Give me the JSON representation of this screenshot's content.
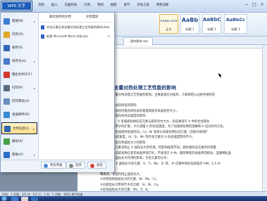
{
  "app": {
    "button_label": "WPS 文字",
    "tabs": [
      "开始",
      "插入",
      "页面布局",
      "引用",
      "审阅",
      "视图",
      "章节",
      "开发工具",
      "特色功能"
    ],
    "window_controls": [
      "−",
      "□",
      "×"
    ]
  },
  "ribbon": {
    "styles": [
      {
        "sample": "AaBbCcDd",
        "label": "正文"
      },
      {
        "sample": "AaBb",
        "label": "标题 1"
      },
      {
        "sample": "AaBbC",
        "label": "标题 2"
      },
      {
        "sample": "AaBbCc",
        "label": "标题 3"
      }
    ]
  },
  "document_tab": "...是的影响.doc",
  "document": {
    "small_header": "综述",
    "title": "及其含量对热处理工艺性能的影响",
    "lines": [
      "元素及其含量对热处理工艺性能的影响，主要表现在对加热、冷却和回火过程中组织的",
      "响。",
      "合金元素对加热转变的影响",
      "金元素对钢加热时奥氏体形成的速度和奥氏体晶粒的大小。",
      "合金元素对奥氏体形成速度的影响",
      "r、Mo、W、V 等强碳化物形成元素与碳的亲合力大，形成难溶于 A 中的合金碳化",
      "显著减慢碳原子的扩散，大大减慢 A 的形成速度。为了加速碳化物的溶解和 A 成分的均匀化，",
      "需要提高加热温度并保温时间。Co、Ni 等部分非碳化物形成元素，因增大碳的扩",
      "加快 A 的形成速度。Al、Si、Mn 等合金元素对 A 形成速度影响不大。",
      "合金元素对奥氏体晶粒大小的影响",
      "大多数合金元素有阻止 A 晶粒长大的作用，但影响程度不同。碳化物形成元素的作用最",
      "明显，因形成碳化物在奥氏体晶界处钉扎，不易溶于 A 中，能阻碍奥氏体晶界的移动，显著细化晶",
      "粒，按照对晶粒长大作用的影响，合金元素可分为：",
      "①强烈阻止 A 晶粒长大的元素：V、Ti、Nb、Zr 等，Al 在钢中易形成高熔点 AlN，2.5 Al",
      "O",
      "细奥氏，也强烈阻止晶粒长大。",
      "②中等阻碍晶粒长大的元素：W、Mo、Cr。",
      "③对晶粒长大影响不大的元素：Si、Ni、Cu。",
      "④促进晶粒长大的元素：Mn、P、B。"
    ]
  },
  "status_bar": "页码：1  页面：1/2  节：1/1  行：1  列：1  字数：1832  拼写检查",
  "file_menu": {
    "items": [
      {
        "label": "新建(N)",
        "icon": "new-icon",
        "arrow": "▸",
        "color": "#3f7fd0"
      },
      {
        "label": "打开(O)",
        "icon": "open-icon",
        "arrow": "",
        "color": "#e2a72b"
      },
      {
        "label": "保存(S)",
        "icon": "save-icon",
        "arrow": "",
        "color": "#3566b8"
      },
      {
        "label": "另存为(A)",
        "icon": "save-as-icon",
        "arrow": "▸",
        "color": "#4a7ac8"
      },
      {
        "label": "输出为PDF(F)",
        "icon": "pdf-icon",
        "arrow": "",
        "color": "#d2382f"
      },
      {
        "label": "打印(P)",
        "icon": "print-icon",
        "arrow": "▸",
        "color": "#5b6b80"
      },
      {
        "label": "打印预览(V)",
        "icon": "print-preview-icon",
        "arrow": "",
        "color": "#6b8fc0"
      },
      {
        "label": "发送邮件(D)",
        "icon": "mail-icon",
        "arrow": "",
        "color": "#3b8cd4"
      },
      {
        "label": "文件信息(I)",
        "icon": "file-info-icon",
        "arrow": "▸",
        "color": "#2f64b0"
      },
      {
        "label": "备份(K)",
        "icon": "backup-icon",
        "arrow": "",
        "color": "#4aa04a"
      },
      {
        "label": "帮助(H)",
        "icon": "help-icon",
        "arrow": "▸",
        "color": "#2b6ec9"
      }
    ],
    "recent_header": "最近使用的文档",
    "folders_header": "文档漫游",
    "recent": [
      {
        "label": "合金元素及其含量对热处理工艺性能的影响.doc",
        "pin": "⊕"
      },
      {
        "label": "新建 Microsoft Word 文档.doc",
        "pin": "⊕"
      }
    ],
    "bottom_buttons": [
      {
        "label": "更多界面",
        "icon": "more-icon",
        "color": "#4a8bd6"
      },
      {
        "label": "选项",
        "icon": "options-icon",
        "color": "#888"
      },
      {
        "label": "退出",
        "icon": "exit-icon",
        "color": "#d34141"
      }
    ]
  }
}
